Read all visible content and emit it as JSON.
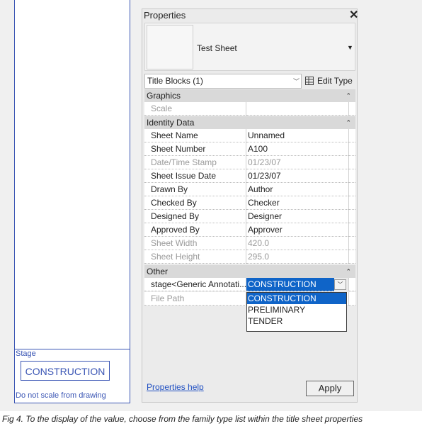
{
  "sheet": {
    "stage_label": "Stage",
    "stage_value": "CONSTRUCTION",
    "note": "Do not scale from drawing"
  },
  "palette": {
    "title": "Properties",
    "close_glyph": "✕",
    "type_name": "Test Sheet",
    "filter_value": "Title Blocks (1)",
    "edit_type_label": "Edit Type",
    "groups": {
      "graphics": "Graphics",
      "identity": "Identity Data",
      "other": "Other"
    },
    "rows": {
      "scale": {
        "k": "Scale",
        "v": ""
      },
      "sheet_name": {
        "k": "Sheet Name",
        "v": "Unnamed"
      },
      "sheet_number": {
        "k": "Sheet Number",
        "v": "A100"
      },
      "datetime": {
        "k": "Date/Time Stamp",
        "v": "01/23/07"
      },
      "issue_date": {
        "k": "Sheet Issue Date",
        "v": "01/23/07"
      },
      "drawn_by": {
        "k": "Drawn By",
        "v": "Author"
      },
      "checked_by": {
        "k": "Checked By",
        "v": "Checker"
      },
      "designed_by": {
        "k": "Designed By",
        "v": "Designer"
      },
      "approved_by": {
        "k": "Approved By",
        "v": "Approver"
      },
      "sheet_width": {
        "k": "Sheet Width",
        "v": "420.0"
      },
      "sheet_height": {
        "k": "Sheet Height",
        "v": "295.0"
      },
      "stage": {
        "k": "stage<Generic Annotati...",
        "v": "CONSTRUCTION"
      },
      "file_path": {
        "k": "File Path",
        "v": ""
      }
    },
    "dropdown_options": [
      "CONSTRUCTION",
      "PRELIMINARY",
      "TENDER"
    ],
    "selected_option": "CONSTRUCTION",
    "help_link": "Properties help",
    "apply_label": "Apply"
  },
  "caption": "Fig 4. To the display of the value, choose from the family type list within the title sheet properties",
  "icons": {
    "close": "close-icon",
    "collapse": "collapse-chevron-icon",
    "dropdown": "chevron-down-icon",
    "edit_type": "edit-type-icon"
  },
  "colors": {
    "selection": "#0f64c8",
    "sheet_lines": "#3a55b4",
    "link": "#1f4fc2"
  }
}
